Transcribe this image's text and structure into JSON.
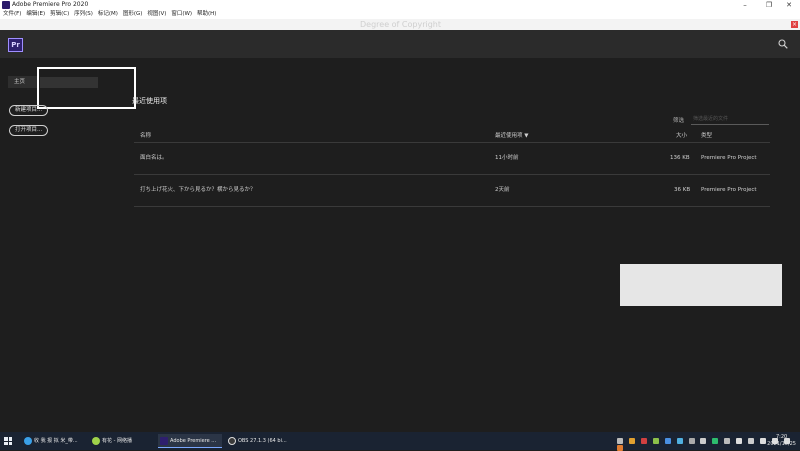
{
  "window": {
    "title": "Adobe Premiere Pro 2020"
  },
  "menu": [
    "文件(F)",
    "编辑(E)",
    "剪辑(C)",
    "序列(S)",
    "标记(M)",
    "图形(G)",
    "视图(V)",
    "窗口(W)",
    "帮助(H)"
  ],
  "header": {
    "logo": "Pr"
  },
  "watermark": "Degree of Copyright",
  "sidebar": {
    "home_label": "主页",
    "new_project": "新建项目...",
    "open_project": "打开项目..."
  },
  "recent": {
    "title": "最近使用项",
    "filter_label": "筛选",
    "filter_placeholder": "筛选最近的文件",
    "columns": {
      "name": "名称",
      "last_used": "最近使用项",
      "sort_arrow": "▼",
      "size": "大小",
      "type": "类型"
    },
    "rows": [
      {
        "name": "面白名は。",
        "last_used": "11小时前",
        "size": "136 KB",
        "type": "Premiere Pro Project"
      },
      {
        "name": "打ち上げ花火、下から見るか？横から見るか？",
        "last_used": "2天前",
        "size": "36 KB",
        "type": "Premiere Pro Project"
      }
    ]
  },
  "taskbar": {
    "tasks": [
      {
        "label": "收 我 报 拟 米_带..."
      },
      {
        "label": "有花 - 网络播"
      },
      {
        "label": "Adobe Premiere ..."
      },
      {
        "label": "OBS 27.1.3 (64 bi..."
      }
    ],
    "time": "7:20",
    "date": "2021/10/25"
  },
  "colors": {
    "accent": "#9f8fff",
    "background": "#1e1e1e",
    "header": "#2b2b2b"
  }
}
